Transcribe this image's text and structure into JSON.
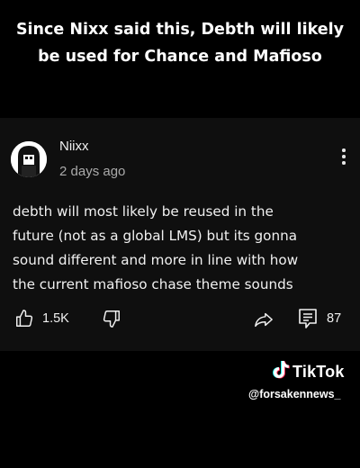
{
  "caption": {
    "line1": "Since Nixx said this, Debth will likely",
    "line2": "be used for Chance and Mafioso"
  },
  "comment": {
    "author": "Niixx",
    "time": "2 days ago",
    "lines": [
      "debth will most likely be reused in the",
      "future (not as a global LMS) but its gonna",
      "sound different and more in line with how",
      "the current mafioso chase theme sounds"
    ],
    "likes": "1.5K",
    "replies": "87"
  },
  "watermark": {
    "brand": "TikTok",
    "handle": "@forsakennews_"
  },
  "icons": {
    "avatar": "avatar-icon",
    "more": "more-vertical-icon",
    "like": "thumbs-up-icon",
    "dislike": "thumbs-down-icon",
    "share": "share-icon",
    "reply": "reply-icon",
    "tiktok": "tiktok-logo-icon"
  }
}
